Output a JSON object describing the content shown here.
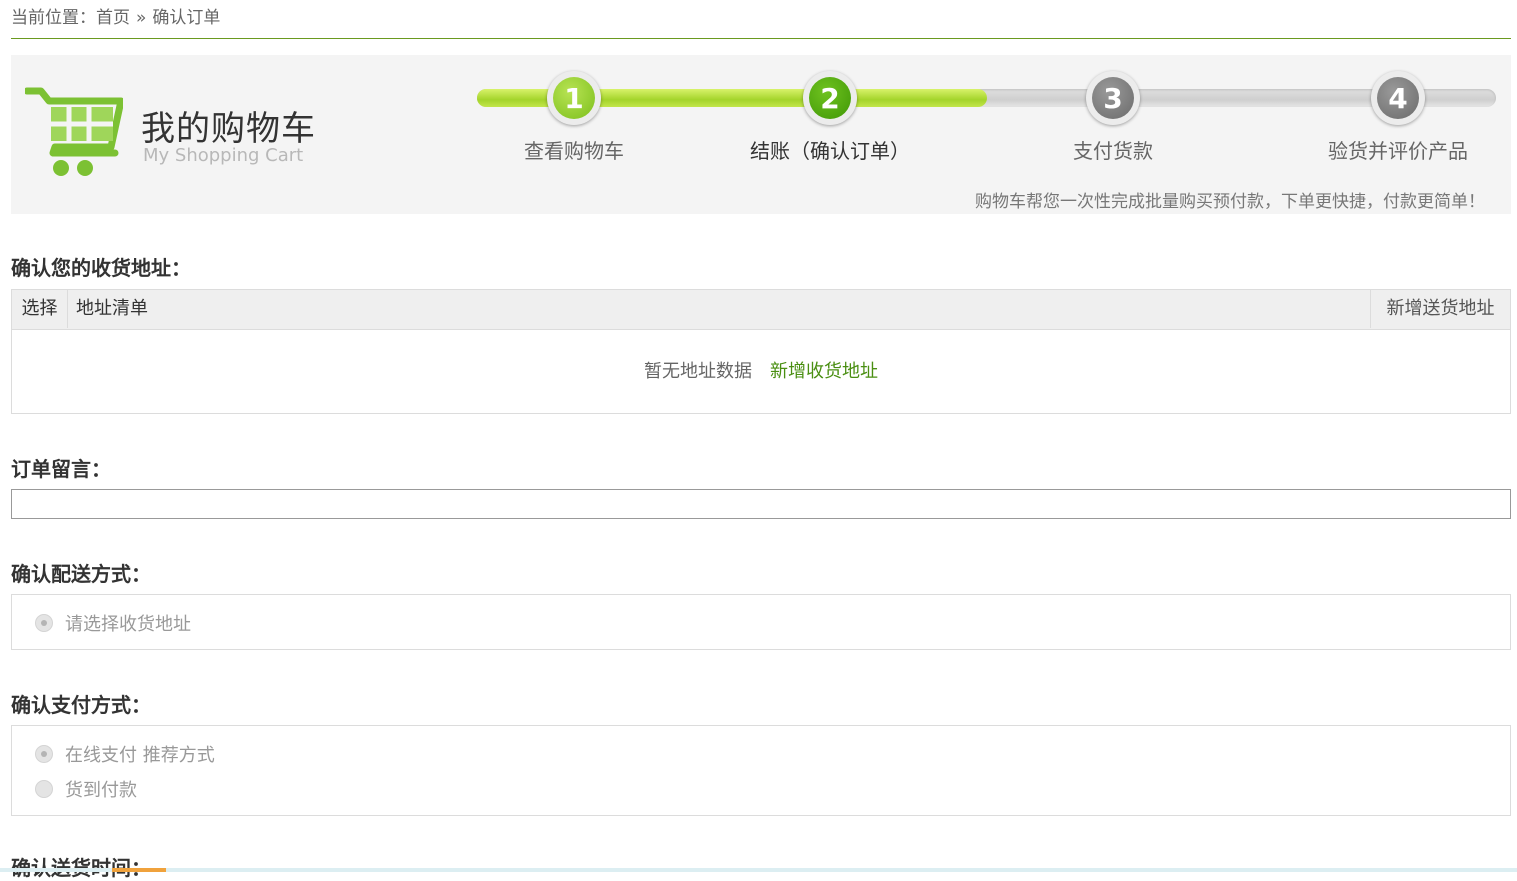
{
  "breadcrumb": {
    "prefix": "当前位置：",
    "home": "首页",
    "separator": "»",
    "current": "确认订单"
  },
  "banner": {
    "title": "我的购物车",
    "subtitle": "My Shopping Cart",
    "logo_icon": "shopping-cart-icon",
    "progress_percent": 50,
    "steps": [
      {
        "number": "1",
        "label": "查看购物车",
        "state": "done"
      },
      {
        "number": "2",
        "label": "结账（确认订单）",
        "state": "current"
      },
      {
        "number": "3",
        "label": "支付货款",
        "state": "todo"
      },
      {
        "number": "4",
        "label": "验货并评价产品",
        "state": "todo"
      }
    ],
    "note": "购物车帮您一次性完成批量购买预付款，下单更快捷，付款更简单！",
    "colors": {
      "accent_green": "#7cbf1b",
      "current_green": "#3f9706",
      "todo_gray": "#6a6a6a"
    }
  },
  "address": {
    "title": "确认您的收货地址：",
    "col_select": "选择",
    "col_list": "地址清单",
    "col_new": "新增送货地址",
    "empty_text": "暂无地址数据",
    "add_link": "新增收货地址"
  },
  "remark": {
    "title": "订单留言：",
    "value": ""
  },
  "delivery": {
    "title": "确认配送方式：",
    "options": [
      {
        "label": "请选择收货地址",
        "checked": true
      }
    ]
  },
  "payment": {
    "title": "确认支付方式：",
    "options": [
      {
        "label": "在线支付 推荐方式",
        "checked": true
      },
      {
        "label": "货到付款",
        "checked": false
      }
    ]
  },
  "delivery_time": {
    "title": "确认送货时间："
  }
}
